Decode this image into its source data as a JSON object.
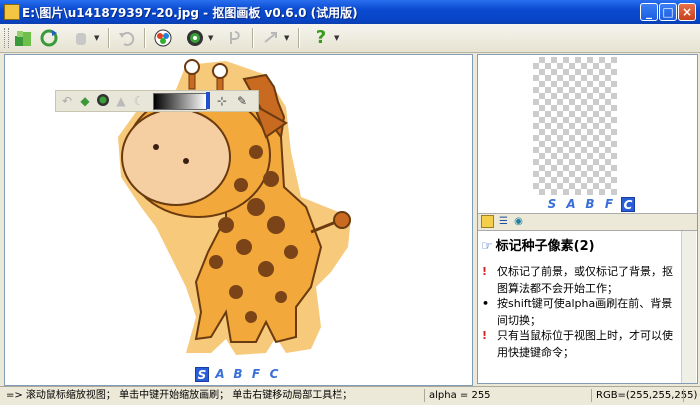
{
  "window": {
    "title": "E:\\图片\\u141879397-20.jpg - 抠图画板 v0.6.0 (试用版)",
    "minimize": "_",
    "maximize": "□",
    "close": "×"
  },
  "toolbar": {
    "icons": [
      "open-icon",
      "refresh-icon",
      "hand-icon",
      "undo-icon",
      "color-picker-icon",
      "brush-icon",
      "redo-icon",
      "pointer-icon",
      "help-icon"
    ],
    "help_label": "?"
  },
  "float_toolbar": {
    "icons": [
      "undo-icon",
      "eraser-icon",
      "brush-icon",
      "drop-icon",
      "moon-icon",
      "zoom-icon",
      "eyedropper-icon"
    ]
  },
  "canvas": {
    "modes": [
      "S",
      "A",
      "B",
      "F",
      "C"
    ],
    "active_mode": "S"
  },
  "preview": {
    "modes": [
      "S",
      "A",
      "B",
      "F",
      "C"
    ],
    "active_mode": "C"
  },
  "hints": {
    "title": "标记种子像素(2)",
    "items": [
      {
        "mark": "!",
        "text": "仅标记了前景，或仅标记了背景，抠图算法都不会开始工作；"
      },
      {
        "mark": "•",
        "text": "按shift键可使alpha画刷在前、背景间切换；"
      },
      {
        "mark": "!",
        "text": "只有当鼠标位于视图上时，才可以使用快捷键命令；"
      }
    ]
  },
  "status": {
    "help": "=> 滚动鼠标缩放视图； 单击中键开始缩放画刷； 单击右键移动局部工具栏；",
    "alpha": "alpha = 255",
    "rgb": "RGB=(255,255,255)"
  },
  "colors": {
    "title_bar": "#0a4ad0",
    "giraffe_body": "#f2a83a",
    "giraffe_spots": "#7a4318",
    "giraffe_face": "#f5cfa2",
    "active_mode": "#2a5ed8"
  }
}
